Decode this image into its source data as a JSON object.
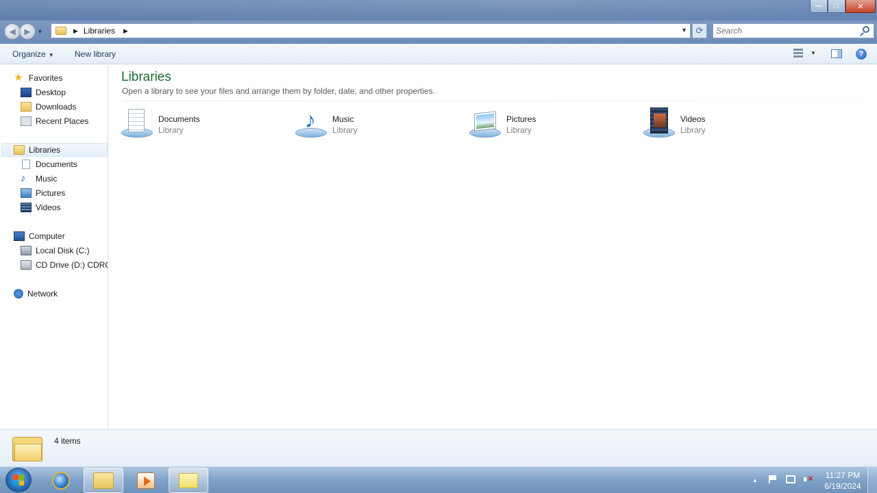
{
  "window": {
    "address_path": "Libraries",
    "search_placeholder": "Search"
  },
  "toolbar": {
    "organize_label": "Organize",
    "new_library_label": "New library"
  },
  "navpane": {
    "favorites": {
      "label": "Favorites",
      "items": [
        {
          "label": "Desktop",
          "icon": "desktop-icon"
        },
        {
          "label": "Downloads",
          "icon": "downloads-icon"
        },
        {
          "label": "Recent Places",
          "icon": "recent-places-icon"
        }
      ]
    },
    "libraries": {
      "label": "Libraries",
      "selected": true,
      "items": [
        {
          "label": "Documents",
          "icon": "documents-icon"
        },
        {
          "label": "Music",
          "icon": "music-icon"
        },
        {
          "label": "Pictures",
          "icon": "pictures-icon"
        },
        {
          "label": "Videos",
          "icon": "videos-icon"
        }
      ]
    },
    "computer": {
      "label": "Computer",
      "items": [
        {
          "label": "Local Disk (C:)",
          "icon": "local-disk-icon"
        },
        {
          "label": "CD Drive (D:) CDROM",
          "icon": "cd-drive-icon"
        }
      ]
    },
    "network": {
      "label": "Network",
      "icon": "network-icon"
    }
  },
  "main": {
    "title": "Libraries",
    "description": "Open a library to see your files and arrange them by folder, date, and other properties.",
    "libraries": [
      {
        "name": "Documents",
        "type": "Library",
        "icon": "documents-library-icon"
      },
      {
        "name": "Music",
        "type": "Library",
        "icon": "music-library-icon"
      },
      {
        "name": "Pictures",
        "type": "Library",
        "icon": "pictures-library-icon"
      },
      {
        "name": "Videos",
        "type": "Library",
        "icon": "videos-library-icon"
      }
    ]
  },
  "details": {
    "item_count": "4 items"
  },
  "taskbar": {
    "time": "11:27 PM",
    "date": "6/19/2024"
  },
  "colors": {
    "title_green": "#1e6b2f",
    "toolbar_text": "#1e395b",
    "taskbar": "#7fa2c8"
  }
}
